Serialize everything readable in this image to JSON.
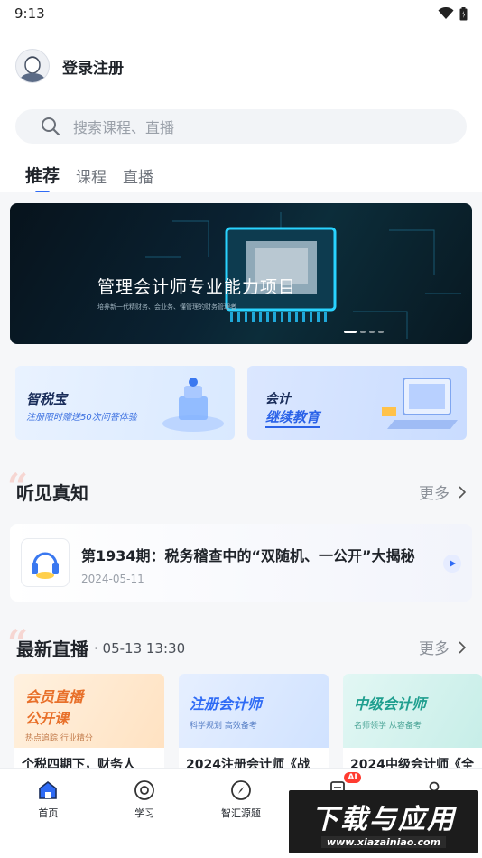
{
  "status_bar": {
    "time": "9:13"
  },
  "profile": {
    "login_label": "登录注册"
  },
  "search": {
    "placeholder": "搜索课程、直播"
  },
  "tabs": [
    {
      "label": "推荐",
      "active": true
    },
    {
      "label": "课程",
      "active": false
    },
    {
      "label": "直播",
      "active": false
    }
  ],
  "banner": {
    "title": "管理会计师专业能力项目",
    "subtitle": "培养新一代精财务、会业务、懂管理的财务管理者",
    "slides_total": 4,
    "slide_active": 1
  },
  "promos": {
    "left": {
      "title": "智税宝",
      "subtitle": "注册限时赠送50次问答体验"
    },
    "right": {
      "title_line1": "会计",
      "title_line2": "继续教育"
    }
  },
  "podcast_section": {
    "title": "听见真知",
    "more_label": "更多",
    "item": {
      "title": "第1934期：税务稽查中的“双随机、一公开”大揭秘",
      "date": "2024-05-11"
    }
  },
  "live_section": {
    "title": "最新直播",
    "meta": "· 05-13 13:30",
    "more_label": "更多",
    "cards": [
      {
        "thumb_title_1": "会员直播",
        "thumb_title_2": "公开课",
        "thumb_sub": "热点追踪 行业精分",
        "name": "个税四期下，财务人"
      },
      {
        "thumb_title_1": "注册会计师",
        "thumb_sub": "科学规划 高效备考",
        "name": "2024注册会计师《战"
      },
      {
        "thumb_title_1": "中级会计师",
        "thumb_sub": "名师领学 从容备考",
        "name": "2024中级会计师《全"
      }
    ]
  },
  "bottom_nav": [
    {
      "label": "首页",
      "icon": "home-icon",
      "active": true
    },
    {
      "label": "学习",
      "icon": "learn-icon",
      "active": false
    },
    {
      "label": "智汇源题",
      "icon": "compass-icon",
      "active": false
    },
    {
      "label": "",
      "icon": "document-icon",
      "badge": "AI",
      "active": false
    },
    {
      "label": "",
      "icon": "user-icon",
      "active": false
    }
  ],
  "watermark": {
    "text": "下载与应用",
    "url": "www.xiazainiao.com"
  },
  "colors": {
    "accent": "#2f6bf5",
    "badge": "#ff3b30"
  }
}
